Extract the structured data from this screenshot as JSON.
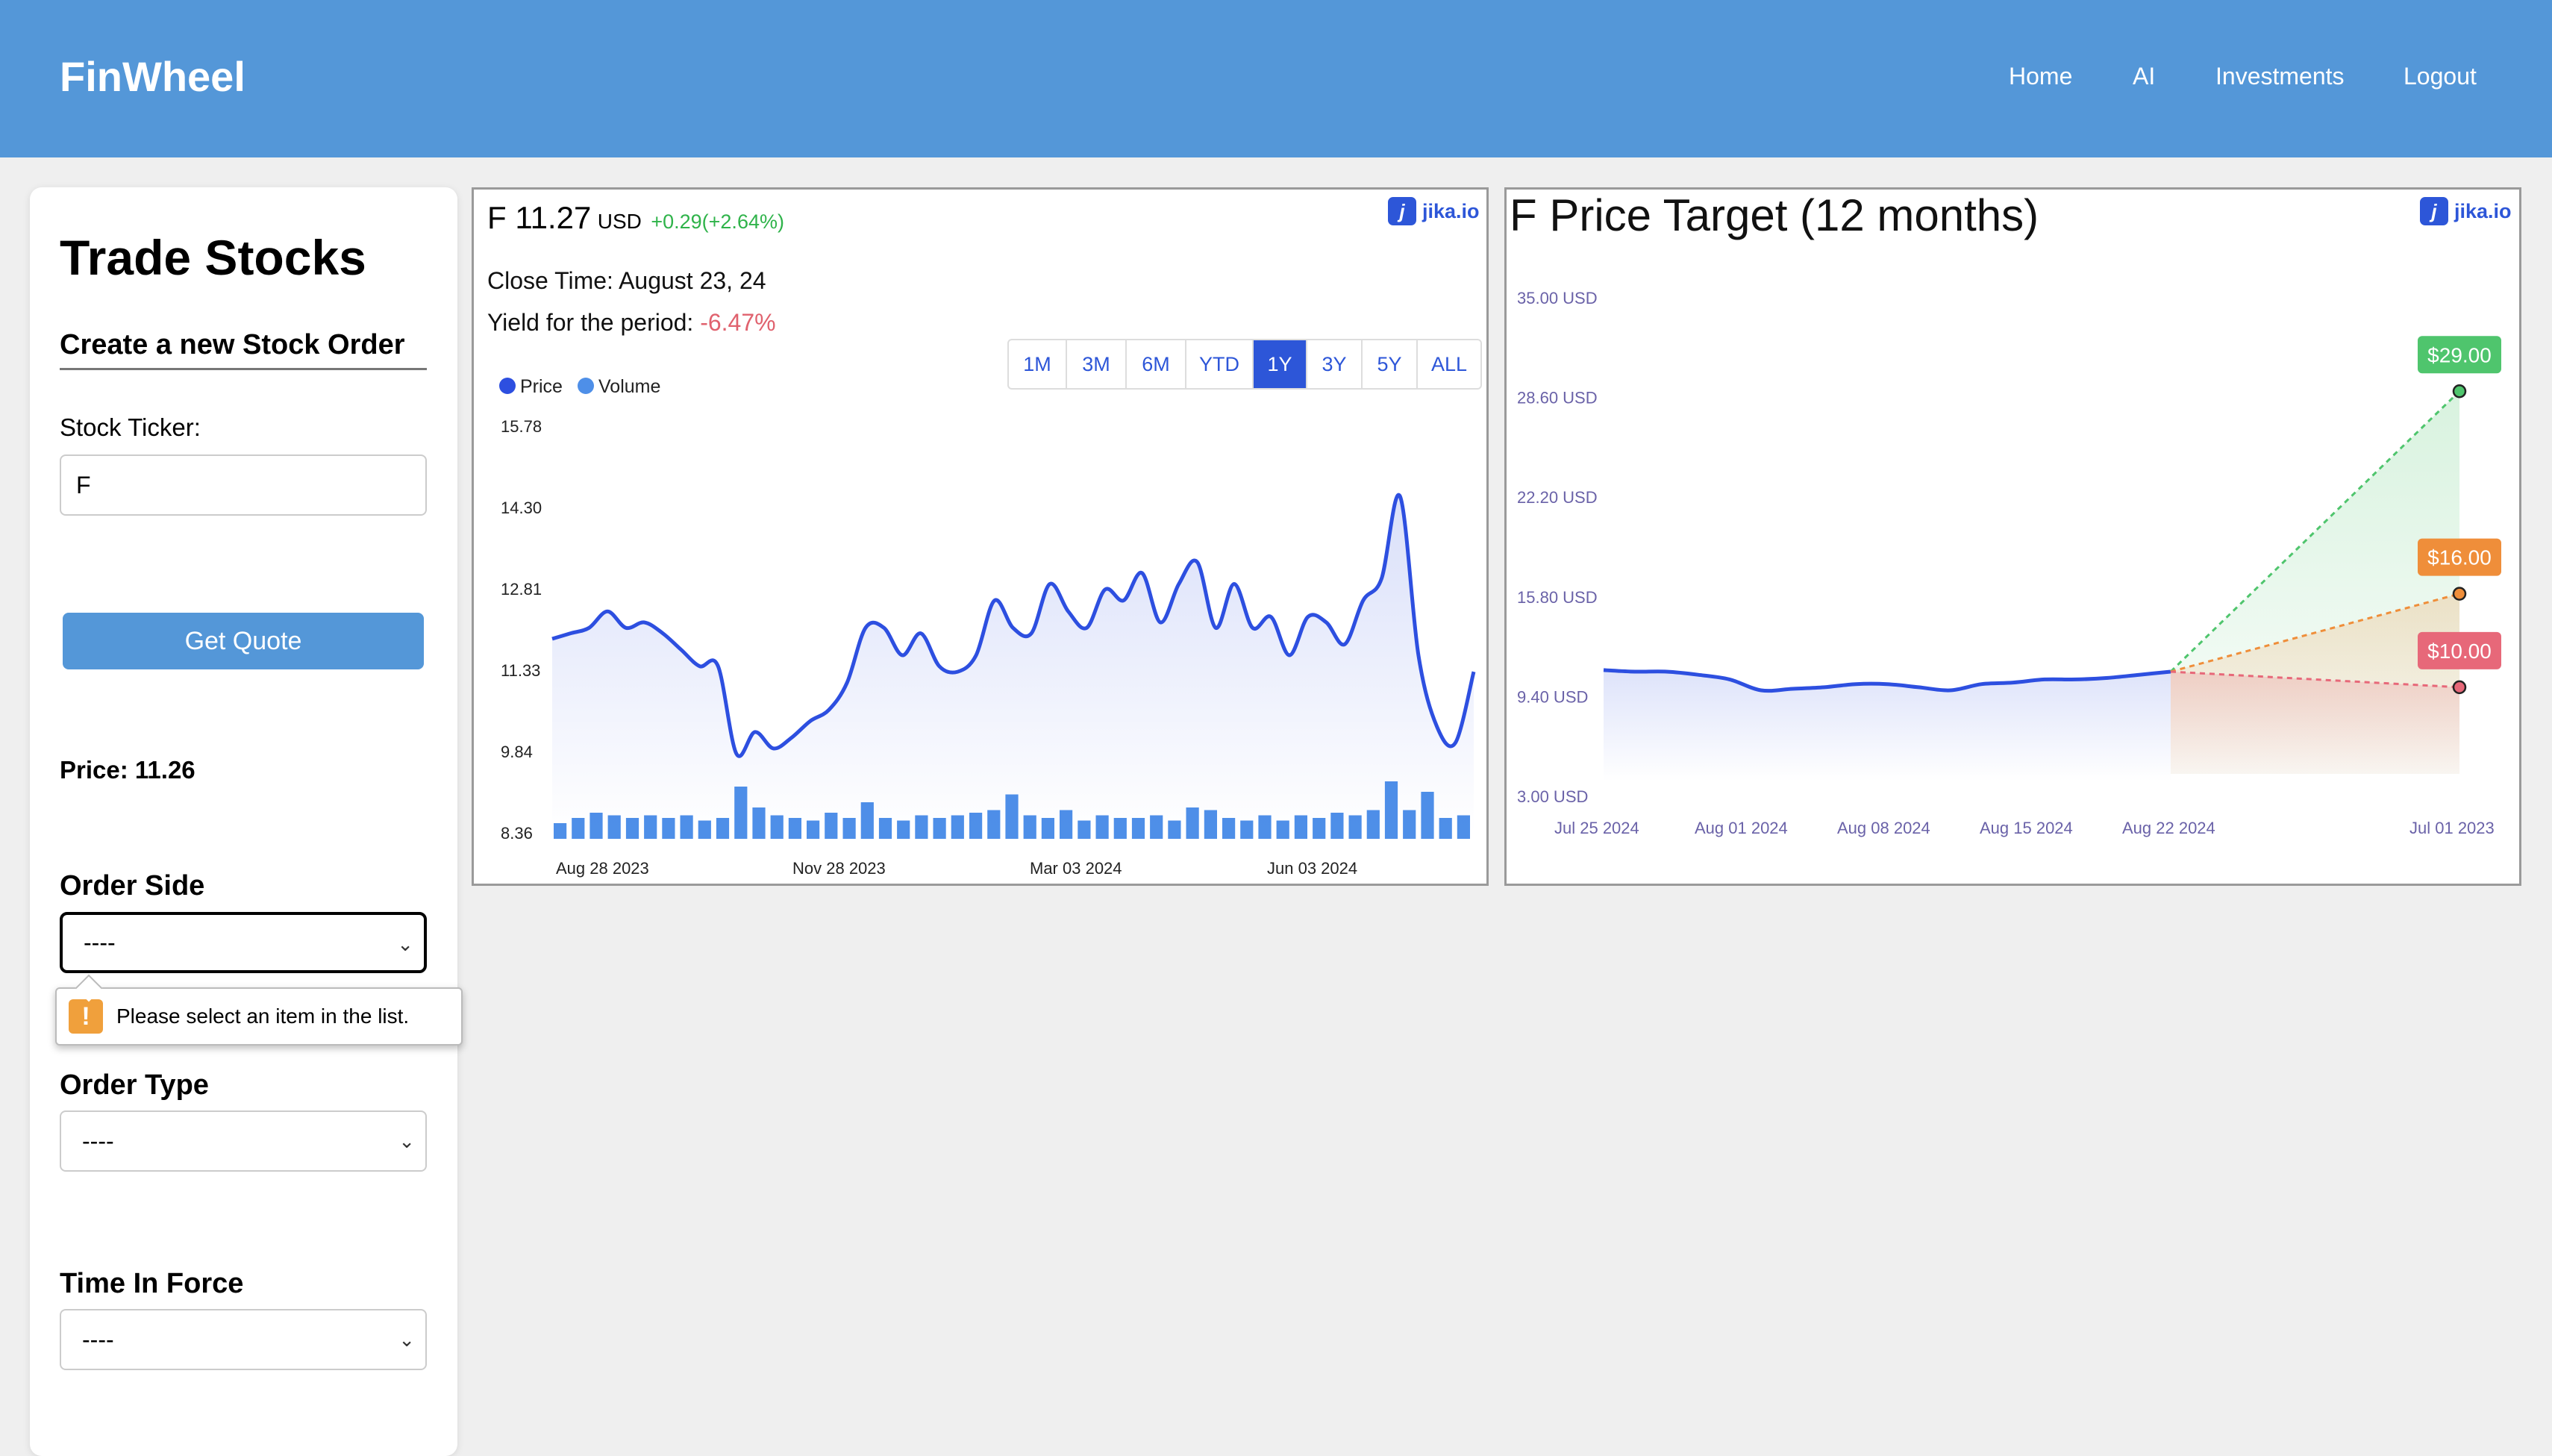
{
  "navbar": {
    "brand": "FinWheel",
    "links": [
      "Home",
      "AI",
      "Investments",
      "Logout"
    ]
  },
  "sidebar": {
    "title": "Trade Stocks",
    "subtitle": "Create a new Stock Order",
    "ticker_label": "Stock Ticker:",
    "ticker_value": "F",
    "quote_button": "Get Quote",
    "price_text": "Price: 11.26",
    "order_side_label": "Order Side",
    "order_side_value": "----",
    "validation_message": "Please select an item in the list.",
    "order_type_label": "Order Type",
    "order_type_value": "----",
    "time_in_force_label": "Time In Force",
    "time_in_force_value": "----"
  },
  "quote_widget": {
    "symbol_price": "F 11.27",
    "currency": "USD",
    "change": "+0.29(+2.64%)",
    "close_time": "Close Time: August 23, 24",
    "yield_label": "Yield for the period:",
    "yield_value": "-6.47%",
    "ranges": [
      "1M",
      "3M",
      "6M",
      "YTD",
      "1Y",
      "3Y",
      "5Y",
      "ALL"
    ],
    "active_range": "1Y",
    "brand": "jika.io",
    "colors": {
      "price": "#2d4fe0",
      "volume": "#4e8fe8",
      "positive": "#2fb34a",
      "negative": "#e0626e"
    }
  },
  "price_target_widget": {
    "title": "F Price Target (12 months)",
    "brand": "jika.io"
  },
  "chart_data": [
    {
      "type": "line",
      "legend": [
        "Price",
        "Volume"
      ],
      "yticks": [
        "15.78",
        "14.30",
        "12.81",
        "11.33",
        "9.84",
        "8.36"
      ],
      "xticks": [
        "Aug 28 2023",
        "Nov 28 2023",
        "Mar 03 2024",
        "Jun 03 2024"
      ],
      "ylim": [
        8.36,
        15.78
      ],
      "series": [
        {
          "name": "Price",
          "values": [
            11.9,
            12.0,
            12.1,
            12.4,
            12.1,
            12.2,
            12.0,
            11.7,
            11.4,
            11.4,
            9.8,
            10.2,
            9.9,
            10.1,
            10.4,
            10.6,
            11.1,
            12.1,
            12.1,
            11.6,
            12.0,
            11.4,
            11.3,
            11.6,
            12.6,
            12.1,
            12.0,
            12.9,
            12.4,
            12.1,
            12.8,
            12.6,
            13.1,
            12.2,
            12.9,
            13.3,
            12.1,
            12.9,
            12.1,
            12.3,
            11.6,
            12.3,
            12.2,
            11.8,
            12.6,
            13.0,
            14.5,
            11.6,
            10.3,
            10.0,
            11.3
          ]
        },
        {
          "name": "Volume",
          "values": [
            0.3,
            0.4,
            0.5,
            0.45,
            0.4,
            0.45,
            0.4,
            0.45,
            0.35,
            0.4,
            1.0,
            0.6,
            0.45,
            0.4,
            0.35,
            0.5,
            0.4,
            0.7,
            0.4,
            0.35,
            0.45,
            0.4,
            0.45,
            0.5,
            0.55,
            0.85,
            0.45,
            0.4,
            0.55,
            0.35,
            0.45,
            0.4,
            0.4,
            0.45,
            0.35,
            0.6,
            0.55,
            0.4,
            0.35,
            0.45,
            0.35,
            0.45,
            0.4,
            0.5,
            0.45,
            0.55,
            1.1,
            0.55,
            0.9,
            0.4,
            0.45
          ]
        }
      ]
    },
    {
      "type": "line",
      "title": "F Price Target (12 months)",
      "yticks": [
        "35.00 USD",
        "28.60 USD",
        "22.20 USD",
        "15.80 USD",
        "9.40 USD",
        "3.00 USD"
      ],
      "xticks": [
        "Jul 25 2024",
        "Aug 01 2024",
        "Aug 08 2024",
        "Aug 15 2024",
        "Aug 22 2024",
        "Jul 01 2023"
      ],
      "ylim": [
        3.0,
        35.0
      ],
      "series": [
        {
          "name": "Price",
          "values": [
            11.1,
            11.0,
            11.0,
            10.8,
            10.5,
            9.8,
            9.9,
            10.0,
            10.2,
            10.2,
            10.0,
            9.8,
            10.2,
            10.3,
            10.5,
            10.5,
            10.6,
            10.8,
            11.0
          ]
        }
      ],
      "targets": [
        {
          "label": "$29.00",
          "value": 29.0,
          "color": "#4fc56d"
        },
        {
          "label": "$16.00",
          "value": 16.0,
          "color": "#ef8e3a"
        },
        {
          "label": "$10.00",
          "value": 10.0,
          "color": "#e76879"
        }
      ]
    }
  ]
}
